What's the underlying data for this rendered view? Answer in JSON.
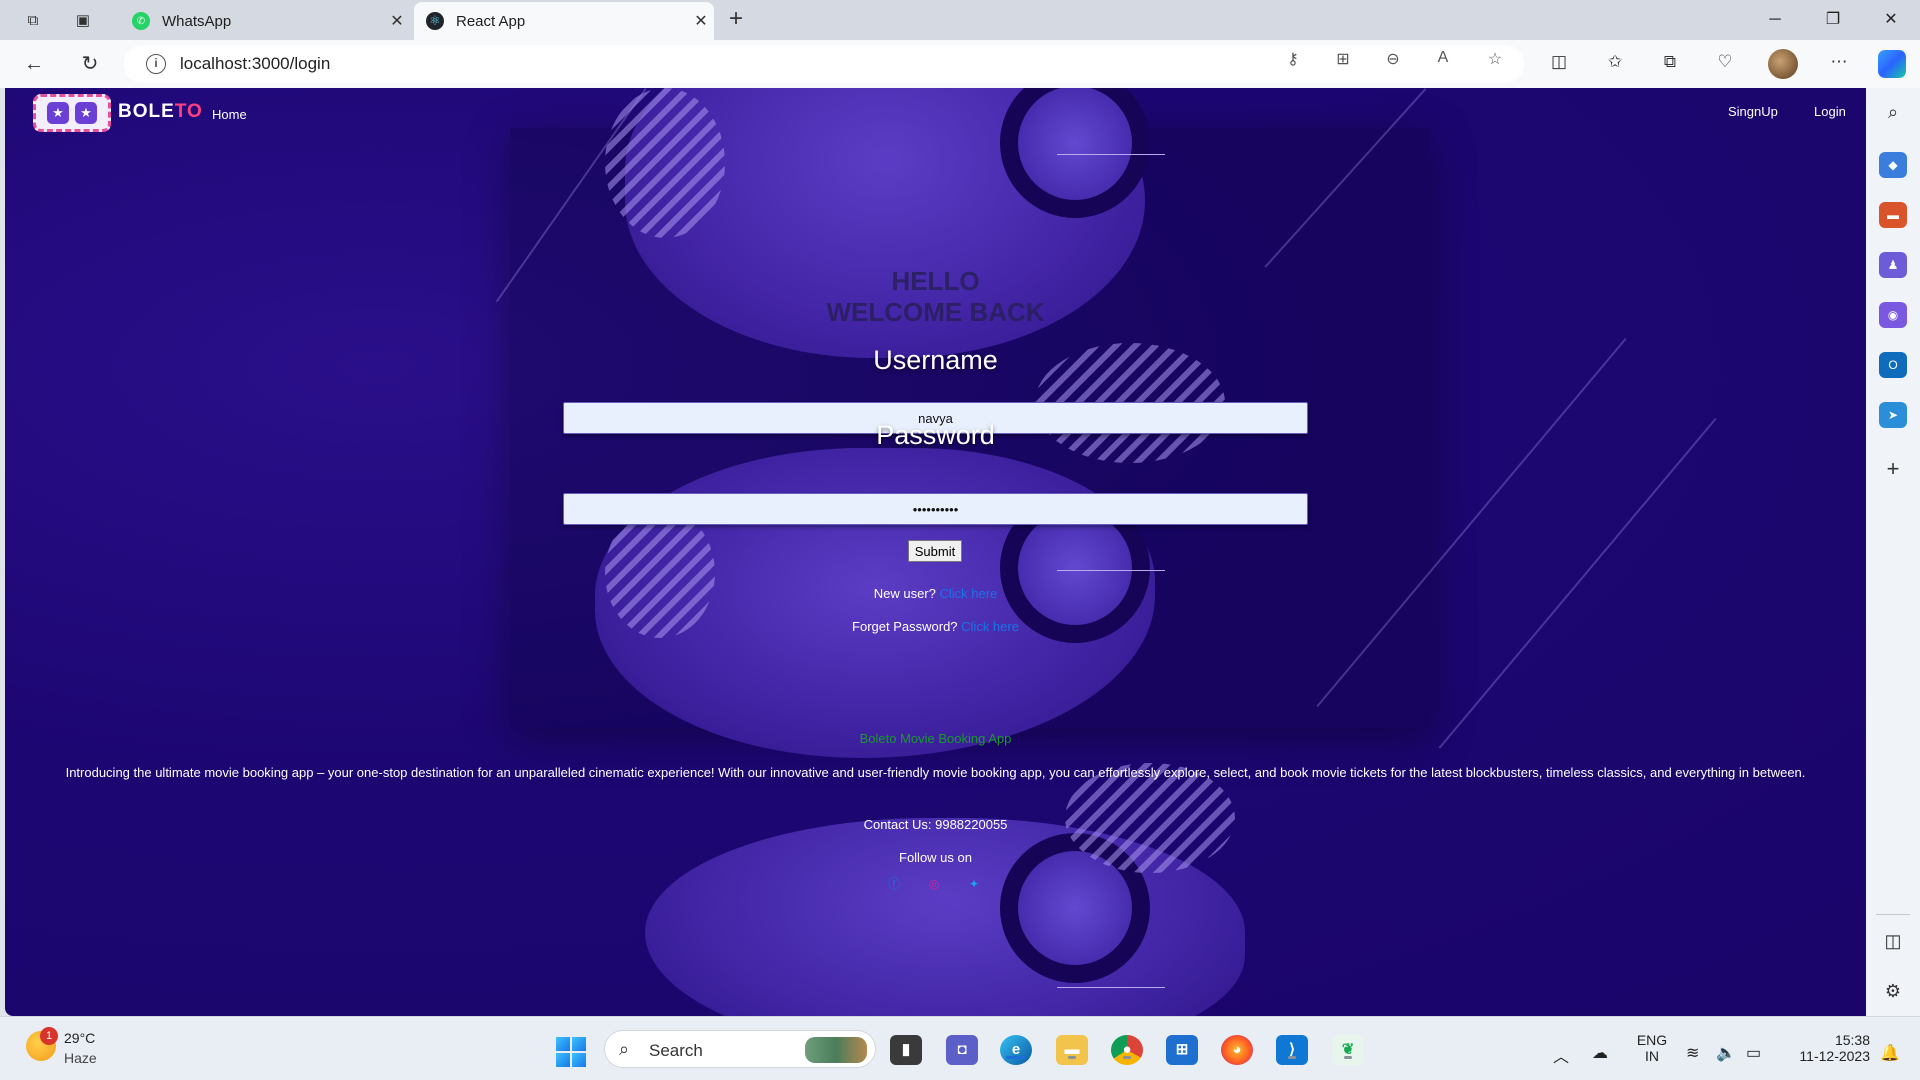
{
  "browser": {
    "tabs": [
      {
        "title": "WhatsApp",
        "active": false,
        "icon": "whatsapp-icon"
      },
      {
        "title": "React App",
        "active": true,
        "icon": "react-icon"
      }
    ],
    "url": "localhost:3000/login"
  },
  "navbar": {
    "brand_left": "BOLE",
    "brand_right": "TO",
    "home": "Home",
    "signup": "SingnUp",
    "login": "Login"
  },
  "login": {
    "greeting_line1": "HELLO",
    "greeting_line2": "WELCOME BACK",
    "username_label": "Username",
    "username_value": "navya",
    "password_label": "Password",
    "password_value": "••••••••••",
    "submit": "Submit",
    "new_user_text": "New user?",
    "new_user_link": "Click here",
    "forget_text": "Forget Password?",
    "forget_link": "Click here"
  },
  "footer": {
    "title": "Boleto Movie Booking App",
    "description": "Introducing the ultimate movie booking app – your one-stop destination for an unparalleled cinematic experience! With our innovative and user-friendly movie booking app, you can effortlessly explore, select, and book movie tickets for the latest blockbusters, timeless classics, and everything in between.",
    "contact": "Contact Us: 9988220055",
    "follow": "Follow us on",
    "social": [
      "facebook-icon",
      "instagram-icon",
      "twitter-icon"
    ]
  },
  "taskbar": {
    "weather_temp": "29°C",
    "weather_desc": "Haze",
    "weather_badge": "1",
    "search": "Search",
    "lang_line1": "ENG",
    "lang_line2": "IN",
    "time": "15:38",
    "date": "11-12-2023"
  },
  "colors": {
    "page_bg": "#1c0672",
    "accent_link": "#1a73e8",
    "footer_title": "#1a9a2a",
    "brand_accent": "#ff3f7f"
  }
}
